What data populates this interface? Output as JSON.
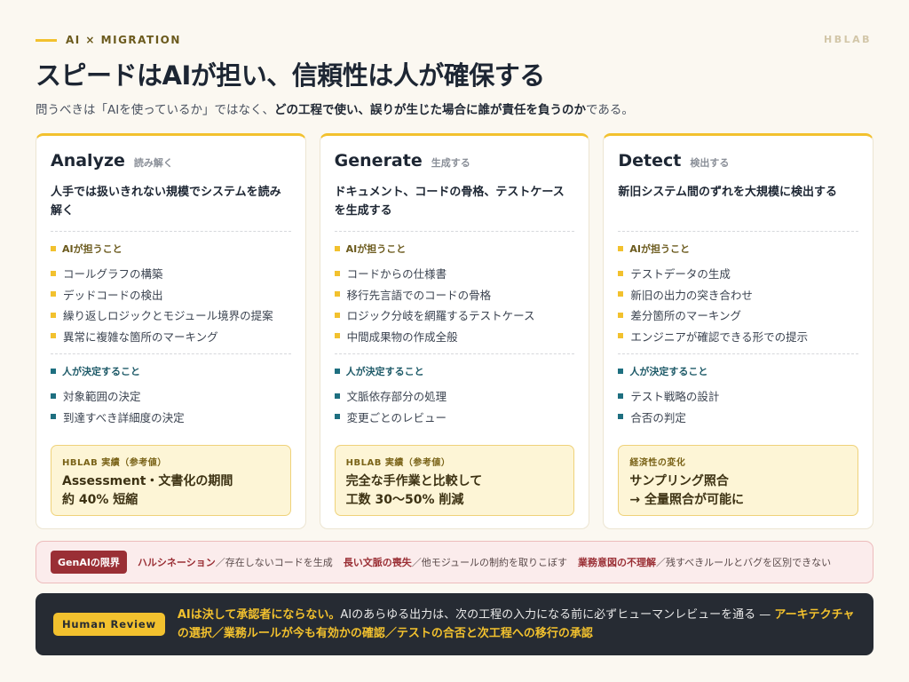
{
  "header": {
    "eyebrow": "AI × MIGRATION",
    "brand": "HBLAB",
    "title": "スピードはAIが担い、信頼性は人が確保する",
    "subtitle_a": "問うべきは「AIを使っているか」ではなく、",
    "subtitle_b": "どの工程で使い、誤りが生じた場合に誰が責任を負うのか",
    "subtitle_c": "である。"
  },
  "cards": [
    {
      "title": "Analyze",
      "jp": "読み解く",
      "desc": "人手では扱いきれない規模でシステムを読み解く",
      "ai_label": "AIが担うこと",
      "ai_items": [
        "コールグラフの構築",
        "デッドコードの検出",
        "繰り返しロジックとモジュール境界の提案",
        "異常に複雑な箇所のマーキング"
      ],
      "human_label": "人が決定すること",
      "human_items": [
        "対象範囲の決定",
        "到達すべき詳細度の決定"
      ],
      "callout_label": "HBLAB 実績（参考値）",
      "callout_line1": "Assessment・文書化の期間",
      "callout_line2": "約 40% 短縮"
    },
    {
      "title": "Generate",
      "jp": "生成する",
      "desc": "ドキュメント、コードの骨格、テストケースを生成する",
      "ai_label": "AIが担うこと",
      "ai_items": [
        "コードからの仕様書",
        "移行先言語でのコードの骨格",
        "ロジック分岐を網羅するテストケース",
        "中間成果物の作成全般"
      ],
      "human_label": "人が決定すること",
      "human_items": [
        "文脈依存部分の処理",
        "変更ごとのレビュー"
      ],
      "callout_label": "HBLAB 実績（参考値）",
      "callout_line1": "完全な手作業と比較して",
      "callout_line2": "工数 30〜50% 削減"
    },
    {
      "title": "Detect",
      "jp": "検出する",
      "desc": "新旧システム間のずれを大規模に検出する",
      "ai_label": "AIが担うこと",
      "ai_items": [
        "テストデータの生成",
        "新旧の出力の突き合わせ",
        "差分箇所のマーキング",
        "エンジニアが確認できる形での提示"
      ],
      "human_label": "人が決定すること",
      "human_items": [
        "テスト戦略の設計",
        "合否の判定"
      ],
      "callout_label": "経済性の変化",
      "callout_line1": "サンプリング照合",
      "callout_line2": "→ 全量照合が可能に"
    }
  ],
  "limits": {
    "badge": "GenAIの限界",
    "items": [
      {
        "term": "ハルシネーション",
        "desc": "／存在しないコードを生成"
      },
      {
        "term": "長い文脈の喪失",
        "desc": "／他モジュールの制約を取りこぼす"
      },
      {
        "term": "業務意図の不理解",
        "desc": "／残すべきルールとバグを区別できない"
      }
    ]
  },
  "review": {
    "badge": "Human Review",
    "lead": "AIは決して承認者にならない。",
    "body": "AIのあらゆる出力は、次の工程の入力になる前に必ずヒューマンレビューを通る — ",
    "highlight": "アーキテクチャの選択／業務ルールが今も有効かの確認／テストの合否と次工程への移行の承認"
  },
  "colors": {
    "accent": "#f2c12e",
    "human": "#1e6f80",
    "danger": "#9a2f35",
    "dark": "#262b33"
  }
}
